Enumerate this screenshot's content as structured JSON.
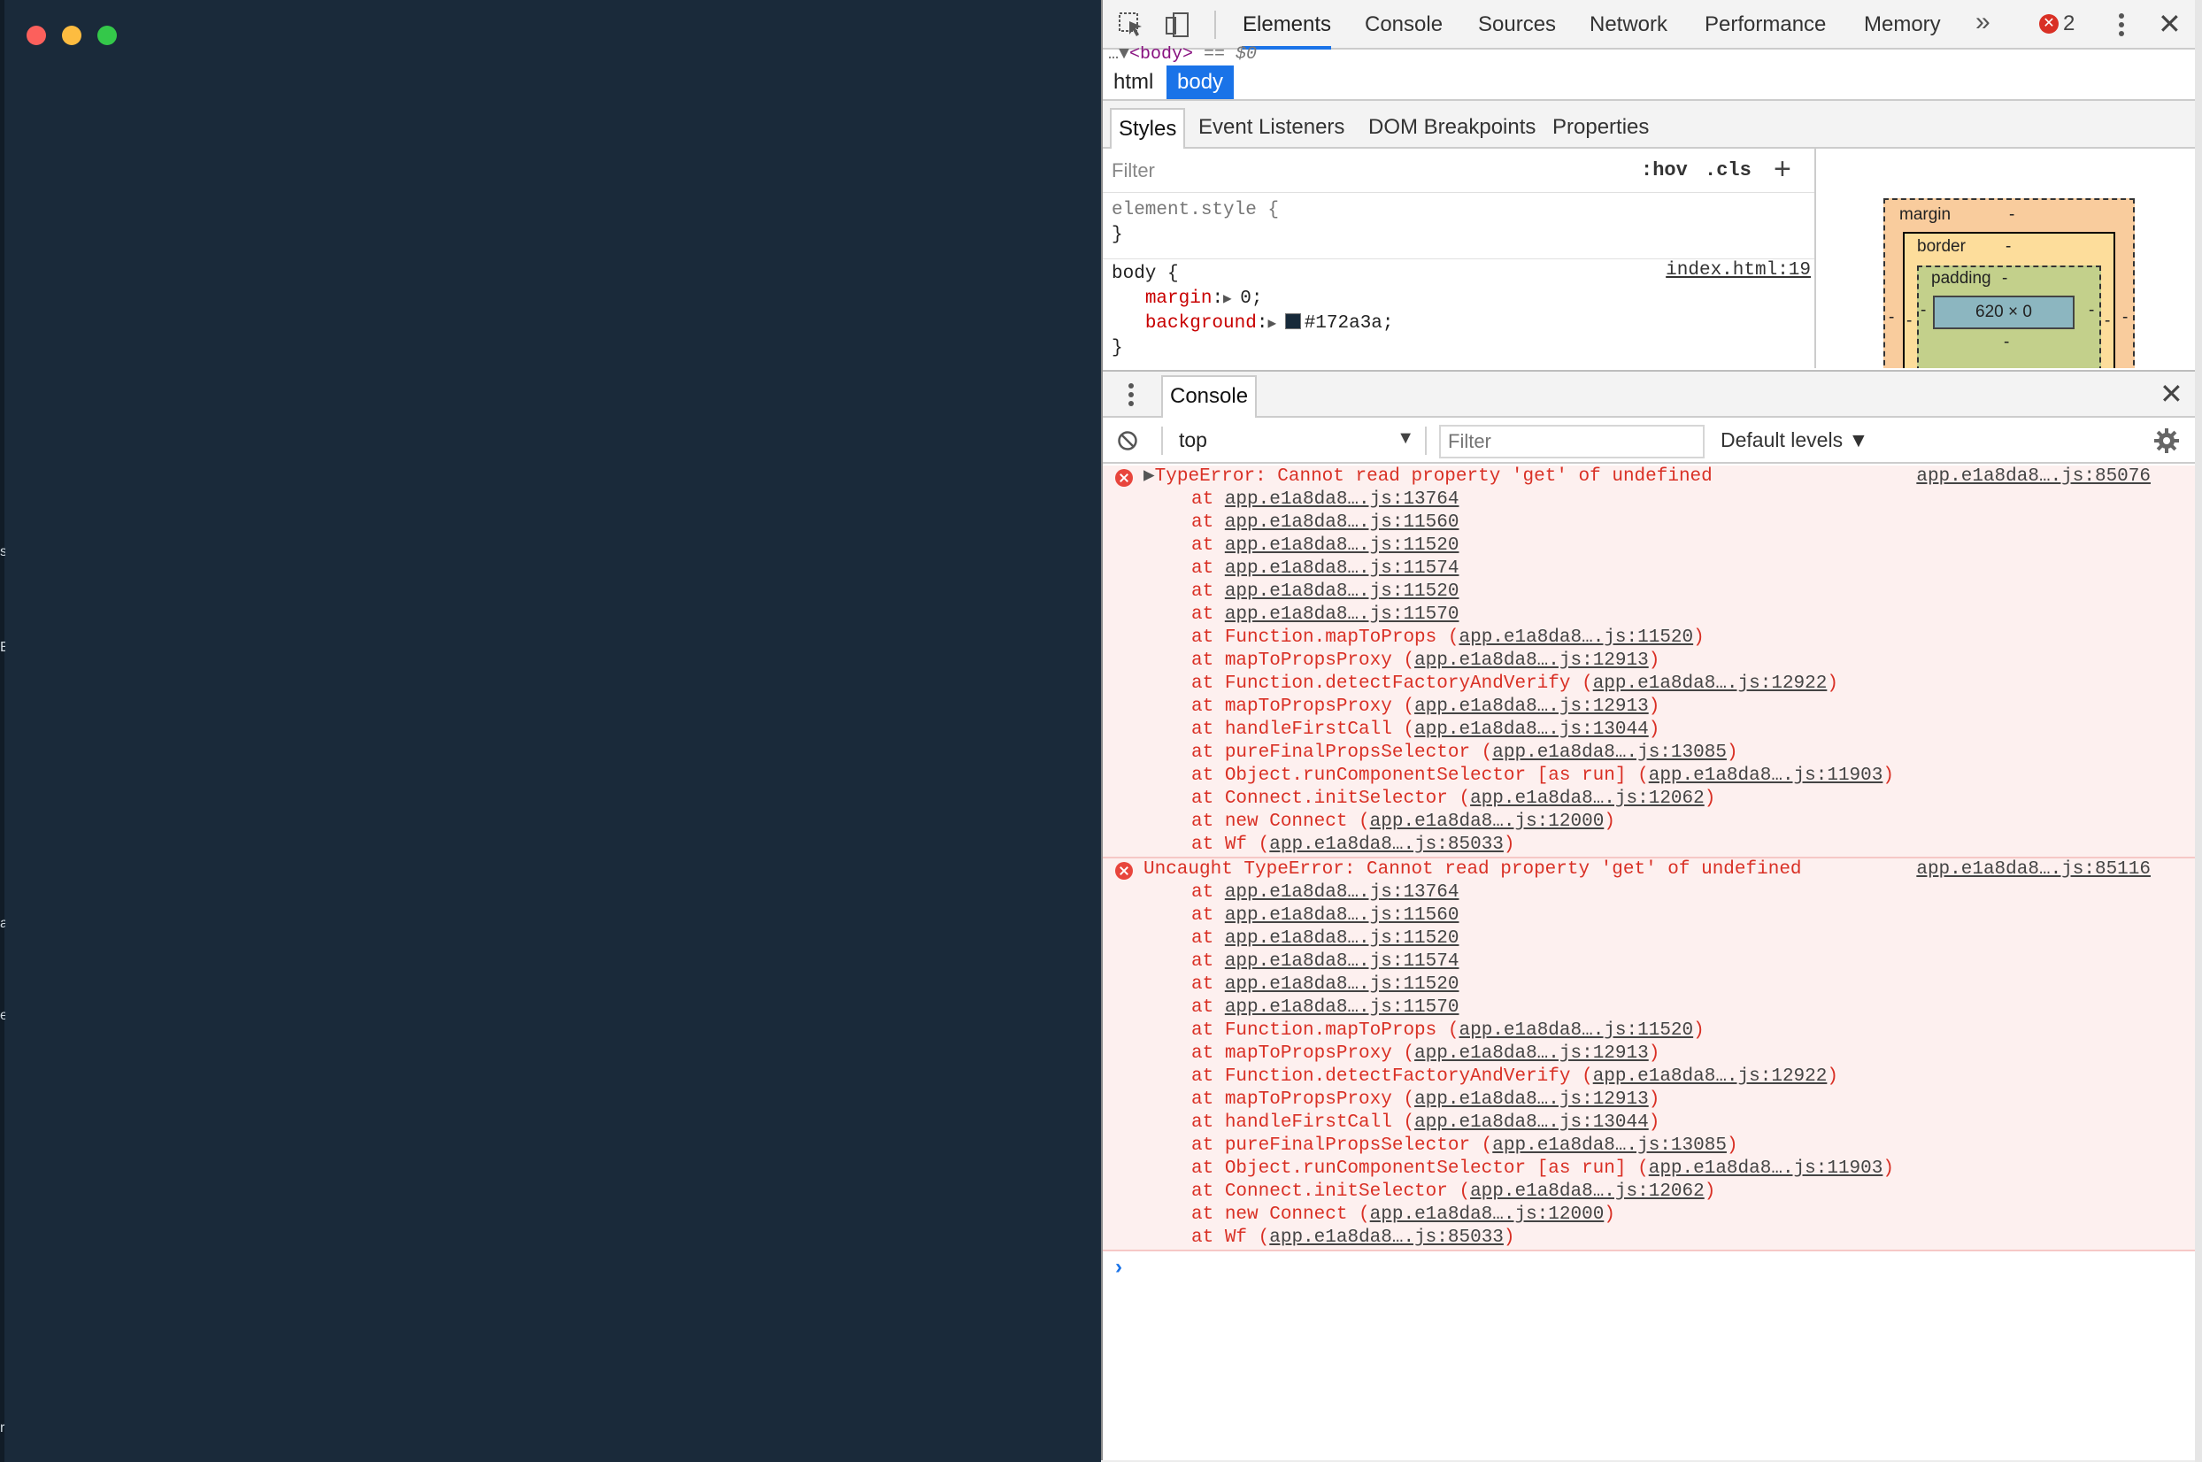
{
  "window": {
    "traffic_lights": {
      "close": "#fc605c",
      "minimize": "#fdbc40",
      "maximize": "#34c84a"
    },
    "app_background": "#1a2a3a",
    "edge_glyphs": [
      "s",
      "E",
      "a",
      "e",
      "r"
    ]
  },
  "devtools": {
    "tabs": [
      {
        "label": "Elements",
        "active": true
      },
      {
        "label": "Console",
        "active": false
      },
      {
        "label": "Sources",
        "active": false
      },
      {
        "label": "Network",
        "active": false
      },
      {
        "label": "Performance",
        "active": false
      },
      {
        "label": "Memory",
        "active": false
      }
    ],
    "more_tabs": "»",
    "error_count": "2",
    "accent": "#1a73e8"
  },
  "elements": {
    "dom_peek": {
      "prefix": "…▼",
      "tag": "<body>",
      "suffix": " == $0"
    },
    "breadcrumb": [
      "html",
      "body"
    ],
    "subtabs": [
      "Styles",
      "Event Listeners",
      "DOM Breakpoints",
      "Properties"
    ],
    "styles": {
      "filter_placeholder": "Filter",
      "hov": ":hov",
      "cls": ".cls",
      "element_style_open": "element.style {",
      "close_brace": "}",
      "body_selector": "body {",
      "source_link": "index.html:19",
      "properties": [
        {
          "name": "margin",
          "value": "0;"
        },
        {
          "name": "background",
          "value": "#172a3a;"
        }
      ],
      "swatch_color": "#172a3a"
    },
    "box_model": {
      "margin_label": "margin",
      "border_label": "border",
      "padding_label": "padding",
      "dash": "-",
      "content_size": "620 × 0"
    }
  },
  "console": {
    "tab_label": "Console",
    "context": "top",
    "filter_placeholder": "Filter",
    "levels": "Default levels",
    "messages": [
      {
        "expandable": true,
        "text": "TypeError: Cannot read property 'get' of undefined",
        "source": "app.e1a8da8….js:85076",
        "frames": [
          {
            "fn": "",
            "loc": "app.e1a8da8….js:13764"
          },
          {
            "fn": "",
            "loc": "app.e1a8da8….js:11560"
          },
          {
            "fn": "",
            "loc": "app.e1a8da8….js:11520"
          },
          {
            "fn": "",
            "loc": "app.e1a8da8….js:11574"
          },
          {
            "fn": "",
            "loc": "app.e1a8da8….js:11520"
          },
          {
            "fn": "",
            "loc": "app.e1a8da8….js:11570"
          },
          {
            "fn": "Function.mapToProps",
            "loc": "app.e1a8da8….js:11520"
          },
          {
            "fn": "mapToPropsProxy",
            "loc": "app.e1a8da8….js:12913"
          },
          {
            "fn": "Function.detectFactoryAndVerify",
            "loc": "app.e1a8da8….js:12922"
          },
          {
            "fn": "mapToPropsProxy",
            "loc": "app.e1a8da8….js:12913"
          },
          {
            "fn": "handleFirstCall",
            "loc": "app.e1a8da8….js:13044"
          },
          {
            "fn": "pureFinalPropsSelector",
            "loc": "app.e1a8da8….js:13085"
          },
          {
            "fn": "Object.runComponentSelector [as run]",
            "loc": "app.e1a8da8….js:11903"
          },
          {
            "fn": "Connect.initSelector",
            "loc": "app.e1a8da8….js:12062"
          },
          {
            "fn": "new Connect",
            "loc": "app.e1a8da8….js:12000"
          },
          {
            "fn": "Wf",
            "loc": "app.e1a8da8….js:85033"
          }
        ]
      },
      {
        "expandable": false,
        "text": "Uncaught TypeError: Cannot read property 'get' of undefined",
        "source": "app.e1a8da8….js:85116",
        "frames": [
          {
            "fn": "",
            "loc": "app.e1a8da8….js:13764"
          },
          {
            "fn": "",
            "loc": "app.e1a8da8….js:11560"
          },
          {
            "fn": "",
            "loc": "app.e1a8da8….js:11520"
          },
          {
            "fn": "",
            "loc": "app.e1a8da8….js:11574"
          },
          {
            "fn": "",
            "loc": "app.e1a8da8….js:11520"
          },
          {
            "fn": "",
            "loc": "app.e1a8da8….js:11570"
          },
          {
            "fn": "Function.mapToProps",
            "loc": "app.e1a8da8….js:11520"
          },
          {
            "fn": "mapToPropsProxy",
            "loc": "app.e1a8da8….js:12913"
          },
          {
            "fn": "Function.detectFactoryAndVerify",
            "loc": "app.e1a8da8….js:12922"
          },
          {
            "fn": "mapToPropsProxy",
            "loc": "app.e1a8da8….js:12913"
          },
          {
            "fn": "handleFirstCall",
            "loc": "app.e1a8da8….js:13044"
          },
          {
            "fn": "pureFinalPropsSelector",
            "loc": "app.e1a8da8….js:13085"
          },
          {
            "fn": "Object.runComponentSelector [as run]",
            "loc": "app.e1a8da8….js:11903"
          },
          {
            "fn": "Connect.initSelector",
            "loc": "app.e1a8da8….js:12062"
          },
          {
            "fn": "new Connect",
            "loc": "app.e1a8da8….js:12000"
          },
          {
            "fn": "Wf",
            "loc": "app.e1a8da8….js:85033"
          }
        ]
      }
    ],
    "prompt": "›"
  }
}
